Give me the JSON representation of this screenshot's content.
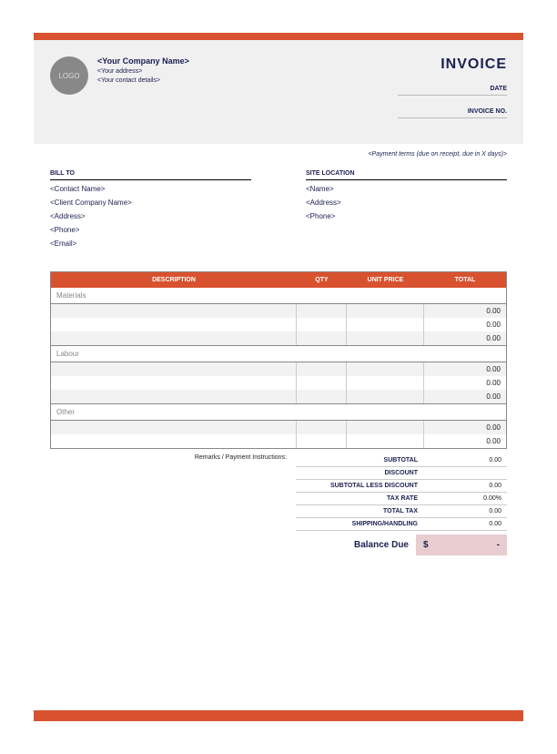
{
  "header": {
    "logo_text": "LOGO",
    "company_name": "<Your Company Name>",
    "address": "<Your address>",
    "contact": "<Your contact details>",
    "title": "INVOICE",
    "date_label": "DATE",
    "invoice_no_label": "INVOICE NO."
  },
  "payment_terms": "<Payment terms (due on receipt, due in X days)>",
  "bill_to": {
    "header": "BILL TO",
    "lines": [
      "<Contact Name>",
      "<Client Company Name>",
      "<Address>",
      "<Phone>",
      "<Email>"
    ]
  },
  "site": {
    "header": "SITE LOCATION",
    "lines": [
      "<Name>",
      "<Address>",
      "<Phone>"
    ]
  },
  "table_headers": {
    "desc": "DESCRIPTION",
    "qty": "QTY",
    "price": "UNIT PRICE",
    "total": "TOTAL"
  },
  "sections": [
    {
      "name": "Materials",
      "rows": [
        {
          "total": "0.00"
        },
        {
          "total": "0.00"
        },
        {
          "total": "0.00"
        }
      ]
    },
    {
      "name": "Labour",
      "rows": [
        {
          "total": "0.00"
        },
        {
          "total": "0.00"
        },
        {
          "total": "0.00"
        }
      ]
    },
    {
      "name": "Other",
      "rows": [
        {
          "total": "0.00"
        },
        {
          "total": "0.00"
        }
      ]
    }
  ],
  "remarks_label": "Remarks / Payment Instructions:",
  "totals": [
    {
      "label": "SUBTOTAL",
      "value": "0.00"
    },
    {
      "label": "DISCOUNT",
      "value": ""
    },
    {
      "label": "SUBTOTAL LESS DISCOUNT",
      "value": "0.00"
    },
    {
      "label": "TAX RATE",
      "value": "0.00%"
    },
    {
      "label": "TOTAL TAX",
      "value": "0.00"
    },
    {
      "label": "SHIPPING/HANDLING",
      "value": "0.00"
    }
  ],
  "balance": {
    "label": "Balance Due",
    "currency": "$",
    "value": "-"
  }
}
